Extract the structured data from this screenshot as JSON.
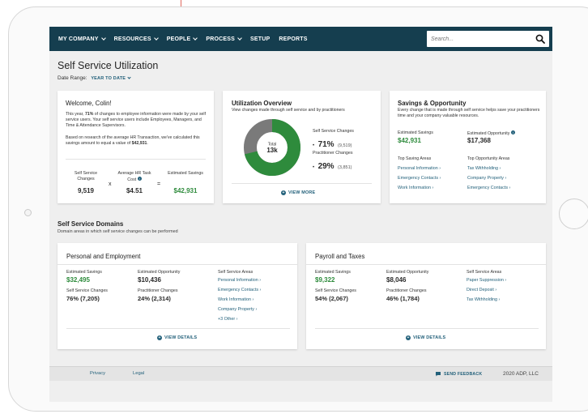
{
  "nav": {
    "items": [
      {
        "label": "MY COMPANY",
        "dropdown": true
      },
      {
        "label": "RESOURCES",
        "dropdown": true
      },
      {
        "label": "PEOPLE",
        "dropdown": true
      },
      {
        "label": "PROCESS",
        "dropdown": true
      },
      {
        "label": "SETUP",
        "dropdown": false
      },
      {
        "label": "REPORTS",
        "dropdown": false
      }
    ],
    "search_placeholder": "Search..."
  },
  "page": {
    "title": "Self Service Utilization",
    "date_range_label": "Date Range:",
    "date_range_value": "YEAR TO DATE"
  },
  "welcome": {
    "title": "Welcome, Colin!",
    "para1_pre": "This year, ",
    "para1_bold": "71%",
    "para1_post": " of changes to employee information were made by your self service users. Your self service users include Employees, Managers, and Time & Attendance Supervisors.",
    "para2_pre": "Based on research of the average HR Transaction, we've calculated this savings amount to equal a value of ",
    "para2_bold": "$42,931",
    "para2_post": ".",
    "calc": {
      "col1_label": "Self Service Changes",
      "col1_value": "9,519",
      "op1": "x",
      "col2_label": "Average HR Task Cost",
      "col2_value": "$4.51",
      "op2": "=",
      "col3_label": "Estimated Savings",
      "col3_value": "$42,931"
    }
  },
  "utilization": {
    "title": "Utilization Overview",
    "subtitle": "View changes made through self service and by practitioners",
    "donut_total_label": "Total",
    "donut_total_value": "13k",
    "self_service_label": "Self Service Changes",
    "self_service_pct": "71%",
    "self_service_count": "(9,519)",
    "practitioner_label": "Practitioner Changes",
    "practitioner_pct": "29%",
    "practitioner_count": "(3,851)",
    "view_more": "VIEW MORE",
    "self_service_fraction": 0.71,
    "colors": {
      "self_service": "#2e8b3c",
      "practitioner": "#7a7a7a"
    }
  },
  "savings": {
    "title": "Savings & Opportunity",
    "subtitle": "Every change that is made through self service helps save your practitioners time and your company valuable resources.",
    "est_savings_label": "Estimated Savings",
    "est_savings_value": "$42,931",
    "est_opp_label": "Estimated Opportunity",
    "est_opp_value": "$17,368",
    "top_saving_label": "Top Saving Areas",
    "top_saving": [
      "Personal Information",
      "Emergency Contacts",
      "Work Information"
    ],
    "top_opp_label": "Top Opportunity Areas",
    "top_opp": [
      "Tax Withholding",
      "Company Property",
      "Emergency Contacts"
    ]
  },
  "domains": {
    "title": "Self Service Domains",
    "subtitle": "Domain areas in which self service changes can be performed",
    "pe": {
      "title": "Personal and Employment",
      "est_savings_label": "Estimated Savings",
      "est_savings_value": "$32,495",
      "est_opp_label": "Estimated Opportunity",
      "est_opp_value": "$10,436",
      "ss_changes_label": "Self Service Changes",
      "ss_changes_value": "76% (7,205)",
      "pr_changes_label": "Practitioner Changes",
      "pr_changes_value": "24% (2,314)",
      "areas_label": "Self Service Areas",
      "areas": [
        "Personal Information",
        "Emergency Contacts",
        "Work Information",
        "Company Property",
        "+3 Other"
      ],
      "view_details": "VIEW DETAILS"
    },
    "pt": {
      "title": "Payroll and Taxes",
      "est_savings_label": "Estimated Savings",
      "est_savings_value": "$9,322",
      "est_opp_label": "Estimated Opportunity",
      "est_opp_value": "$8,046",
      "ss_changes_label": "Self Service Changes",
      "ss_changes_value": "54% (2,067)",
      "pr_changes_label": "Practitioner Changes",
      "pr_changes_value": "46% (1,784)",
      "areas_label": "Self Service Areas",
      "areas": [
        "Paper Suppression",
        "Direct Deposit",
        "Tax Withholding"
      ],
      "view_details": "VIEW DETAILS"
    }
  },
  "footer": {
    "privacy": "Privacy",
    "legal": "Legal",
    "feedback": "SEND FEEDBACK",
    "copyright": "2020 ADP, LLC"
  },
  "icons": [
    "search-icon",
    "chevron-down-icon",
    "info-icon",
    "plus-circle-icon",
    "chat-bubble-icon",
    "cursor-icon"
  ]
}
